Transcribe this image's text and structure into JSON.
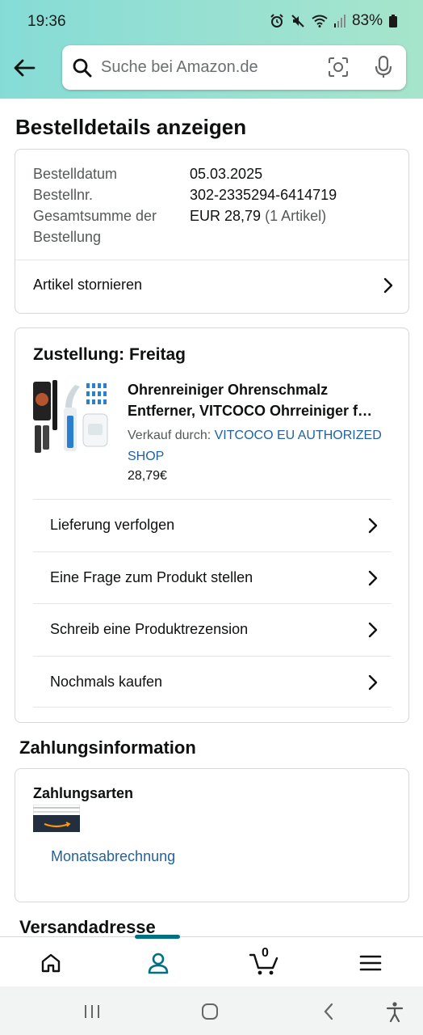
{
  "status_bar": {
    "time": "19:36",
    "battery": "83%"
  },
  "search": {
    "placeholder": "Suche bei Amazon.de"
  },
  "page": {
    "title": "Bestelldetails anzeigen"
  },
  "order_summary": {
    "rows": [
      {
        "label": "Bestelldatum",
        "value": "05.03.2025"
      },
      {
        "label": "Bestellnr.",
        "value": "302-2335294-6414719"
      },
      {
        "label": "Gesamtsumme der",
        "label2": "Bestellung",
        "value": "EUR 28,79",
        "value_extra": "(1 Artikel)"
      }
    ],
    "cancel_label": "Artikel stornieren"
  },
  "shipment": {
    "delivery": "Zustellung: Freitag",
    "product": {
      "title_line1": "Ohrenreiniger Ohrenschmalz",
      "title_line2": "Entferner, VITCOCO Ohrreiniger f…",
      "sold_by_label": "Verkauf durch:",
      "seller_line1": "VITCOCO EU AUTHORIZED",
      "seller_line2": "SHOP",
      "price": "28,79€"
    },
    "actions": [
      {
        "label": "Lieferung verfolgen"
      },
      {
        "label": "Eine Frage zum Produkt stellen"
      },
      {
        "label": "Schreib eine Produktrezension"
      },
      {
        "label": "Nochmals kaufen"
      }
    ]
  },
  "payment": {
    "title": "Zahlungsinformation",
    "methods_label": "Zahlungsarten",
    "method_link": "Monatsabrechnung"
  },
  "shipping": {
    "title": "Versandadresse"
  },
  "bottom_nav": {
    "cart_count": "0"
  },
  "colors": {
    "accent": "#007185",
    "link": "#2162a1",
    "header_start": "#85dcd6",
    "header_end": "#a6e5cc"
  }
}
